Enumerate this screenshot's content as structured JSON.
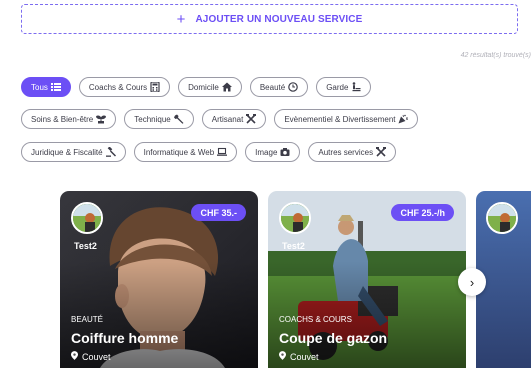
{
  "add_service": {
    "plus": "+",
    "label": "AJOUTER UN NOUVEAU SERVICE"
  },
  "results_text": "42 résultat(s) trouvé(s)",
  "filters": {
    "row1": [
      {
        "label": "Tous",
        "icon": "grid-list-icon",
        "active": true
      },
      {
        "label": "Coachs & Cours",
        "icon": "calculator-icon",
        "active": false
      },
      {
        "label": "Domicile",
        "icon": "home-icon",
        "active": false
      },
      {
        "label": "Beauté",
        "icon": "clock-icon",
        "active": false
      },
      {
        "label": "Garde",
        "icon": "child-icon",
        "active": false
      }
    ],
    "row2": [
      {
        "label": "Soins & Bien-être",
        "icon": "plant-icon",
        "active": false
      },
      {
        "label": "Technique",
        "icon": "wrench-icon",
        "active": false
      },
      {
        "label": "Artisanat",
        "icon": "tools-icon",
        "active": false
      },
      {
        "label": "Evènementiel & Divertissement",
        "icon": "party-icon",
        "active": false
      }
    ],
    "row3": [
      {
        "label": "Juridique & Fiscalité",
        "icon": "gavel-icon",
        "active": false
      },
      {
        "label": "Informatique & Web",
        "icon": "laptop-icon",
        "active": false
      },
      {
        "label": "Image",
        "icon": "camera-icon",
        "active": false
      },
      {
        "label": "Autres services",
        "icon": "tools-icon",
        "active": false
      }
    ]
  },
  "cards": [
    {
      "owner": "Test2",
      "price": "CHF 35.-",
      "category": "BEAUTÉ",
      "title": "Coiffure homme",
      "location": "Couvet",
      "pin_icon": "location-pin-icon"
    },
    {
      "owner": "Test2",
      "price": "CHF 25.-/h",
      "category": "COACHS & COURS",
      "title": "Coupe de gazon",
      "location": "Couvet",
      "pin_icon": "location-pin-icon"
    }
  ],
  "carousel": {
    "next_icon": "chevron-right-icon",
    "next_glyph": "›"
  },
  "colors": {
    "accent": "#6c4ff5",
    "chip_border": "#9a9aa6"
  }
}
